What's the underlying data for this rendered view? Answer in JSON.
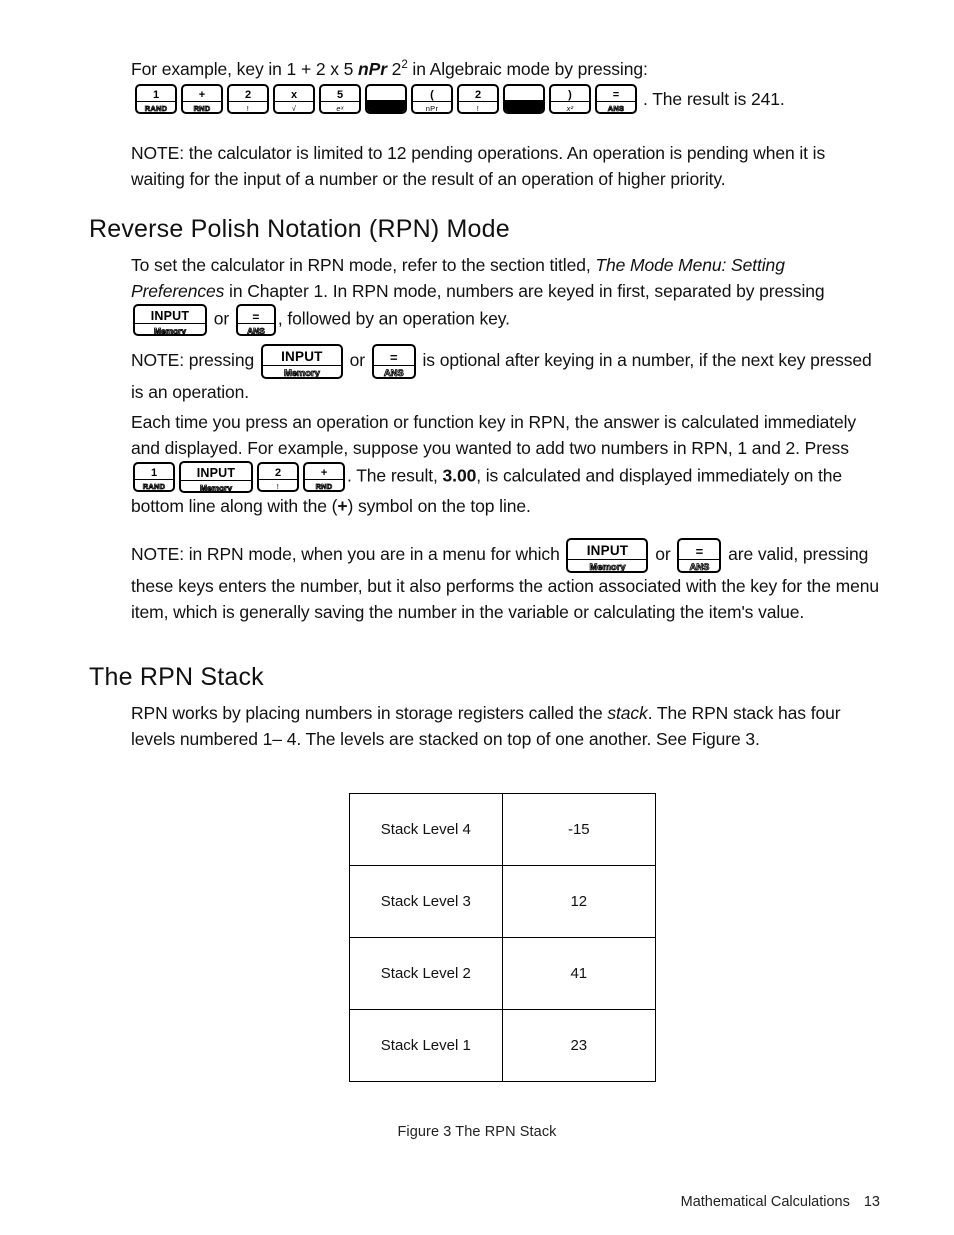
{
  "page": {
    "footer_section": "Mathematical Calculations",
    "footer_page_number": "13"
  },
  "intro": {
    "text_before": "For example, key in 1 + 2 x 5 ",
    "npr": "nPr",
    "text_mid": " 2",
    "superscript": "2",
    "text_after": " in Algebraic mode by pressing:"
  },
  "keystroke_sequence_1": {
    "trailing_text": ". The result is 241.",
    "keys": [
      {
        "top": "1",
        "bottom": "RAND",
        "style": "outline"
      },
      {
        "top": "+",
        "bottom": "RND",
        "style": "outline"
      },
      {
        "top": "2",
        "bottom": "!",
        "style": "plain"
      },
      {
        "top": "x",
        "bottom": "√",
        "style": "plain"
      },
      {
        "top": "5",
        "bottom": "eˣ",
        "style": "plain-italic"
      },
      {
        "top": "",
        "bottom": "",
        "style": "solid"
      },
      {
        "top": "(",
        "bottom": "nPr",
        "style": "plain"
      },
      {
        "top": "2",
        "bottom": "!",
        "style": "plain"
      },
      {
        "top": "",
        "bottom": "",
        "style": "solid"
      },
      {
        "top": ")",
        "bottom": "x²",
        "style": "plain-italic"
      },
      {
        "top": "=",
        "bottom": "ANS",
        "style": "outline"
      }
    ]
  },
  "note_1": "NOTE:  the calculator is limited to 12 pending operations. An operation is pending when it is waiting for the input of a number or the result of an operation of higher priority.",
  "heading_rpn_mode": "Reverse Polish Notation (RPN) Mode",
  "para_set_mode": {
    "part1": "To set the calculator in RPN mode, refer to the section titled, ",
    "italic1": "The Mode Menu: Setting Preferences",
    "part2": " in Chapter 1. In RPN mode, numbers are keyed in first, separated by pressing ",
    "or": " or ",
    "part3": ", followed by an operation key."
  },
  "para_note_2": {
    "part1": "NOTE: pressing ",
    "or": " or ",
    "part2": " is optional after keying in a number, if the next key pressed is an operation."
  },
  "para_each_time": {
    "part1": "Each time you press an operation or function key in RPN, the answer is calculated immediately and displayed. For example, suppose you wanted to add two numbers in RPN, 1 and 2. Press ",
    "part2": ". The result, ",
    "result": "3.00",
    "part3": ", is calculated and displayed immediately on the bottom line along with the (",
    "plus": "+",
    "part4": ") symbol on the top line."
  },
  "keystroke_sequence_2": {
    "keys": [
      {
        "top": "1",
        "bottom": "RAND",
        "style": "outline"
      },
      {
        "top": "INPUT",
        "bottom": "Memory",
        "style": "input"
      },
      {
        "top": "2",
        "bottom": "!",
        "style": "plain"
      },
      {
        "top": "+",
        "bottom": "RND",
        "style": "outline"
      }
    ]
  },
  "para_note_3": {
    "part1": "NOTE: in RPN mode, when you are in a menu for which ",
    "or": " or ",
    "part2": " are valid, pressing these keys enters the number, but it also performs the action associated with the key for the menu item, which is generally saving the number in the variable or calculating the item's value."
  },
  "heading_rpn_stack": "The RPN Stack",
  "para_rpn_works": {
    "part1": "RPN works by placing numbers in storage registers called the ",
    "italic1": "stack",
    "part2": ". The RPN stack has four levels numbered 1– 4. The levels are stacked on top of one another. See Figure 3."
  },
  "input_key": {
    "top": "INPUT",
    "bottom": "Memory"
  },
  "equals_key": {
    "top": "=",
    "bottom": "ANS"
  },
  "figure": {
    "caption": "Figure 3  The RPN Stack",
    "table": {
      "rows": [
        {
          "label": "Stack Level 4",
          "value": "-15"
        },
        {
          "label": "Stack Level 3",
          "value": "12"
        },
        {
          "label": "Stack Level 2",
          "value": "41"
        },
        {
          "label": "Stack Level 1",
          "value": "23"
        }
      ]
    }
  }
}
